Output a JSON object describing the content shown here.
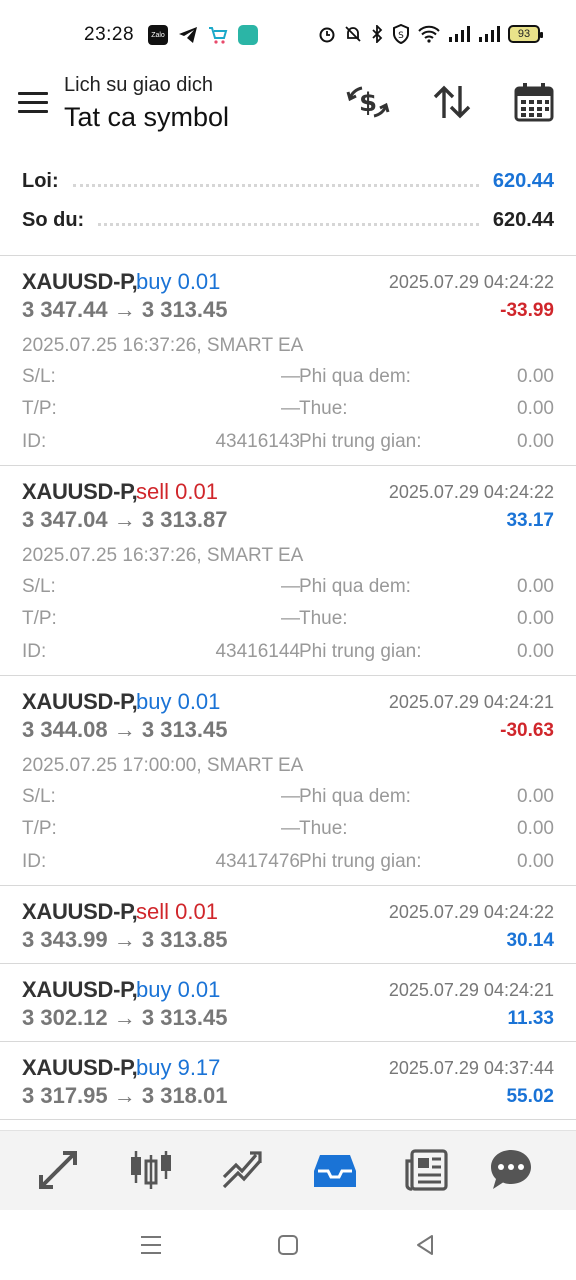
{
  "status_bar": {
    "time": "23:28",
    "battery": "93",
    "left_icons": [
      "zalo-icon",
      "telegram-icon",
      "shopping-cart-icon",
      "app-icon"
    ],
    "right_icons": [
      "alarm-icon",
      "mute-icon",
      "bluetooth-icon",
      "vpn-shield-icon",
      "wifi-icon",
      "signal-icon",
      "signal-icon"
    ]
  },
  "header": {
    "subtitle": "Lich su giao dich",
    "title": "Tat ca symbol",
    "actions": [
      "currency-exchange-icon",
      "sort-icon",
      "calendar-icon"
    ]
  },
  "summary": {
    "profit_label": "Loi:",
    "profit_value": "620.44",
    "balance_label": "So du:",
    "balance_value": "620.44"
  },
  "labels": {
    "sl": "S/L:",
    "tp": "T/P:",
    "id": "ID:",
    "swap": "Phi qua dem:",
    "tax": "Thue:",
    "commission": "Phi trung gian:"
  },
  "deals": [
    {
      "symbol": "XAUUSD-P,",
      "type": "buy 0.01",
      "side": "buy",
      "close_time": "2025.07.29 04:24:22",
      "prices": "3 347.44 → 3 313.45",
      "profit": "-33.99",
      "open_info": "2025.07.25 16:37:26, SMART EA",
      "sl": "—",
      "tp": "—",
      "id": "43416143",
      "swap": "0.00",
      "tax": "0.00",
      "commission": "0.00"
    },
    {
      "symbol": "XAUUSD-P,",
      "type": "sell 0.01",
      "side": "sell",
      "close_time": "2025.07.29 04:24:22",
      "prices": "3 347.04 → 3 313.87",
      "profit": "33.17",
      "open_info": "2025.07.25 16:37:26, SMART EA",
      "sl": "—",
      "tp": "—",
      "id": "43416144",
      "swap": "0.00",
      "tax": "0.00",
      "commission": "0.00"
    },
    {
      "symbol": "XAUUSD-P,",
      "type": "buy 0.01",
      "side": "buy",
      "close_time": "2025.07.29 04:24:21",
      "prices": "3 344.08 → 3 313.45",
      "profit": "-30.63",
      "open_info": "2025.07.25 17:00:00, SMART EA",
      "sl": "—",
      "tp": "—",
      "id": "43417476",
      "swap": "0.00",
      "tax": "0.00",
      "commission": "0.00"
    },
    {
      "symbol": "XAUUSD-P,",
      "type": "sell 0.01",
      "side": "sell",
      "close_time": "2025.07.29 04:24:22",
      "prices": "3 343.99 → 3 313.85",
      "profit": "30.14"
    },
    {
      "symbol": "XAUUSD-P,",
      "type": "buy 0.01",
      "side": "buy",
      "close_time": "2025.07.29 04:24:21",
      "prices": "3 302.12 → 3 313.45",
      "profit": "11.33"
    },
    {
      "symbol": "XAUUSD-P,",
      "type": "buy 9.17",
      "side": "buy",
      "close_time": "2025.07.29 04:37:44",
      "prices": "3 317.95 → 3 318.01",
      "profit": "55.02"
    }
  ],
  "bottom_nav": {
    "items": [
      "quotes-icon",
      "chart-icon",
      "trade-icon",
      "history-icon",
      "news-icon",
      "chat-icon"
    ],
    "active": "history-icon",
    "active_color": "#1a73d6"
  },
  "colors": {
    "buy": "#1a73d6",
    "sell": "#d0262b",
    "profit_positive": "#1a73d6",
    "profit_negative": "#d0262b"
  }
}
